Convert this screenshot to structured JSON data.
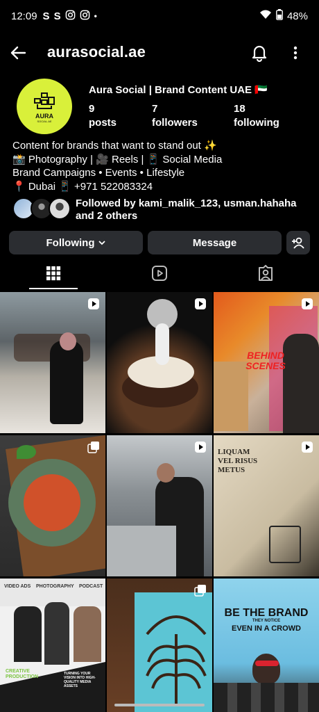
{
  "status": {
    "time": "12:09",
    "battery": "48%",
    "icons": [
      "S",
      "S",
      "◎",
      "◎",
      "•"
    ]
  },
  "header": {
    "username": "aurasocial.ae"
  },
  "profile": {
    "avatar_text": "AURA",
    "avatar_sub": "SOCIAL.AE",
    "display_name": "Aura Social | Brand Content UAE 🇦🇪",
    "stats": [
      {
        "value": "9",
        "label": "posts"
      },
      {
        "value": "7",
        "label": "followers"
      },
      {
        "value": "18",
        "label": "following"
      }
    ],
    "bio": [
      "Content for brands that want to stand out ✨",
      "📸 Photography | 🎥 Reels | 📱 Social Media",
      "Brand Campaigns • Events • Lifestyle",
      "📍 Dubai 📱 +971 522083324"
    ],
    "followed_by": "Followed by kami_malik_123, usman.hahaha and 2 others"
  },
  "actions": {
    "following": "Following",
    "message": "Message"
  },
  "grid": {
    "post6": {
      "l1": "LIQUAM",
      "l2": "VEL RISUS",
      "l3": "METUS"
    },
    "post7": {
      "h1": "VIDEO ADS",
      "h2": "PHOTOGRAPHY",
      "h3": "PODCAST",
      "f1": "CREATIVE",
      "f2": "PRODUCTION",
      "f3": "TURNING YOUR VISION INTO HIGH-QUALITY MEDIA ASSETS"
    },
    "post3": {
      "l1": "BEHIND",
      "l2": "SCENES"
    },
    "post9": {
      "l1": "BE THE BRAND",
      "l2": "THEY NOTICE",
      "l3": "EVEN IN A CROWD"
    }
  },
  "colors": {
    "background": "#000000",
    "button": "#2b2d31",
    "avatar": "#d9f03a"
  }
}
